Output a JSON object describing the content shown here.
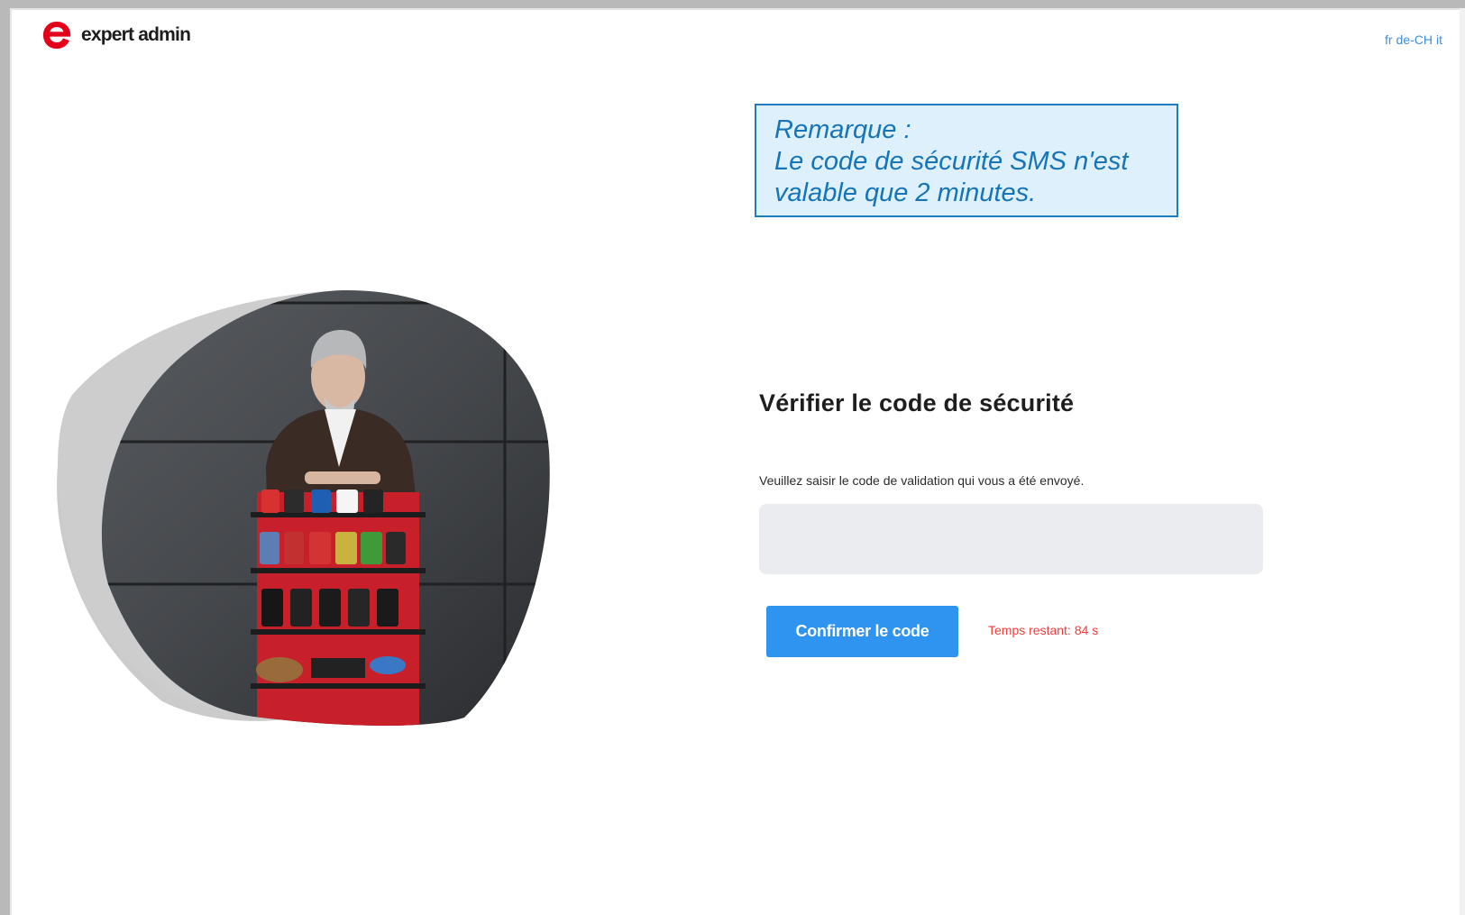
{
  "header": {
    "logo_text": "expert admin",
    "languages": [
      "fr",
      "de-CH",
      "it"
    ]
  },
  "note": {
    "line1": "Remarque :",
    "line2": "Le code de sécurité SMS n'est",
    "line3": "valable que 2 minutes."
  },
  "form": {
    "title": "Vérifier le code de sécurité",
    "hint": "Veuillez saisir le code de validation qui vous a été envoyé.",
    "code_value": "",
    "confirm_label": "Confirmer le code",
    "timer_label": "Temps restant:",
    "timer_value": "84 s"
  },
  "colors": {
    "accent": "#2f93f0",
    "brand": "#e2001a",
    "timer": "#ee3b3b",
    "note_border": "#1e7cc0",
    "note_bg": "#ddf0fb"
  },
  "icons": {
    "logo": "expert-e-logo-icon"
  }
}
